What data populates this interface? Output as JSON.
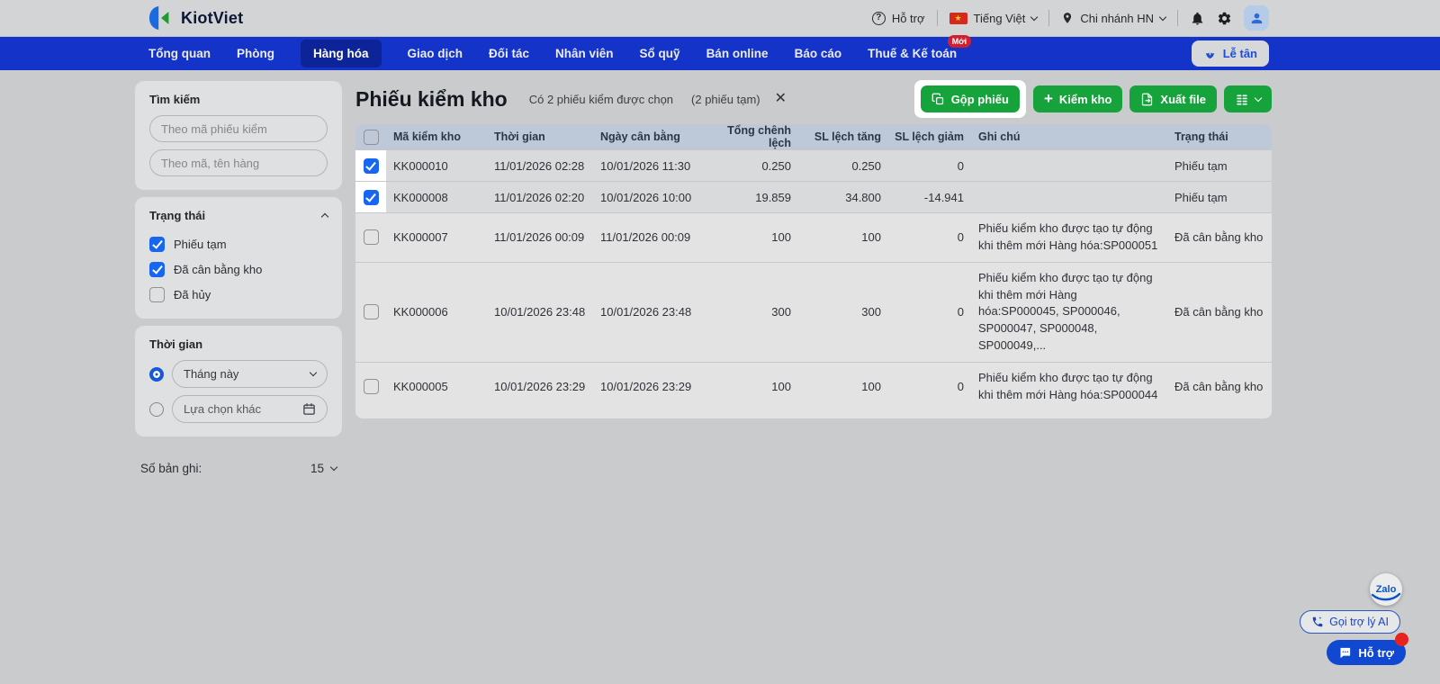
{
  "colors": {
    "nav_blue": "#1433c8",
    "nav_active": "#0d2398",
    "green": "#17a33c",
    "checkbox_blue": "#1766f2",
    "badge_red": "#d21f2f",
    "support_blue": "#1148d2"
  },
  "topbar": {
    "brand": "KiotViet",
    "help": "Hỗ trợ",
    "language": "Tiếng Việt",
    "branch": "Chi nhánh HN"
  },
  "nav": {
    "items": [
      {
        "label": "Tổng quan",
        "active": false
      },
      {
        "label": "Phòng",
        "active": false
      },
      {
        "label": "Hàng hóa",
        "active": true
      },
      {
        "label": "Giao dịch",
        "active": false
      },
      {
        "label": "Đối tác",
        "active": false
      },
      {
        "label": "Nhân viên",
        "active": false
      },
      {
        "label": "Sổ quỹ",
        "active": false
      },
      {
        "label": "Bán online",
        "active": false
      },
      {
        "label": "Báo cáo",
        "active": false
      },
      {
        "label": "Thuế & Kế toán",
        "active": false,
        "badge": "Mới"
      }
    ],
    "reception": "Lễ tân"
  },
  "sidebar": {
    "search": {
      "title": "Tìm kiếm",
      "code_placeholder": "Theo mã phiếu kiểm",
      "item_placeholder": "Theo mã, tên hàng"
    },
    "status": {
      "title": "Trạng thái",
      "options": [
        {
          "label": "Phiếu tạm",
          "checked": true
        },
        {
          "label": "Đã cân bằng kho",
          "checked": true
        },
        {
          "label": "Đã hủy",
          "checked": false
        }
      ]
    },
    "time": {
      "title": "Thời gian",
      "preset": "Tháng này",
      "preset_selected": true,
      "custom": "Lựa chọn khác"
    },
    "records": {
      "label": "Số bản ghi:",
      "value": "15"
    }
  },
  "main": {
    "title": "Phiếu kiểm kho",
    "selection_text": "Có 2 phiếu kiểm được chọn",
    "selection_detail": "(2 phiếu tạm)",
    "close": "✕",
    "buttons": {
      "merge": "Gộp phiếu",
      "stocktake": "Kiểm kho",
      "export": "Xuất file"
    }
  },
  "table": {
    "headers": [
      "Mã kiểm kho",
      "Thời gian",
      "Ngày cân bằng",
      "Tổng chênh lệch",
      "SL lệch tăng",
      "SL lệch giảm",
      "Ghi chú",
      "Trạng thái"
    ],
    "rows": [
      {
        "checked": true,
        "code": "KK000010",
        "time": "11/01/2026 02:28",
        "balance_date": "10/01/2026 11:30",
        "total_diff": "0.250",
        "qty_increase": "0.250",
        "qty_decrease": "0",
        "note": "",
        "status": "Phiếu tạm"
      },
      {
        "checked": true,
        "code": "KK000008",
        "time": "11/01/2026 02:20",
        "balance_date": "10/01/2026 10:00",
        "total_diff": "19.859",
        "qty_increase": "34.800",
        "qty_decrease": "-14.941",
        "note": "",
        "status": "Phiếu tạm"
      },
      {
        "checked": false,
        "code": "KK000007",
        "time": "11/01/2026 00:09",
        "balance_date": "11/01/2026 00:09",
        "total_diff": "100",
        "qty_increase": "100",
        "qty_decrease": "0",
        "note": "Phiếu kiểm kho được tạo tự động khi thêm mới Hàng hóa:SP000051",
        "status": "Đã cân bằng kho"
      },
      {
        "checked": false,
        "code": "KK000006",
        "time": "10/01/2026 23:48",
        "balance_date": "10/01/2026 23:48",
        "total_diff": "300",
        "qty_increase": "300",
        "qty_decrease": "0",
        "note": "Phiếu kiểm kho được tạo tự động khi thêm mới Hàng hóa:SP000045, SP000046, SP000047, SP000048, SP000049,...",
        "status": "Đã cân bằng kho"
      },
      {
        "checked": false,
        "code": "KK000005",
        "time": "10/01/2026 23:29",
        "balance_date": "10/01/2026 23:29",
        "total_diff": "100",
        "qty_increase": "100",
        "qty_decrease": "0",
        "note": "Phiếu kiểm kho được tạo tự động khi thêm mới Hàng hóa:SP000044",
        "status": "Đã cân bằng kho"
      }
    ]
  },
  "floating": {
    "zalo": "Zalo",
    "ai_call": "Gọi trợ lý AI",
    "support": "Hỗ trợ"
  }
}
